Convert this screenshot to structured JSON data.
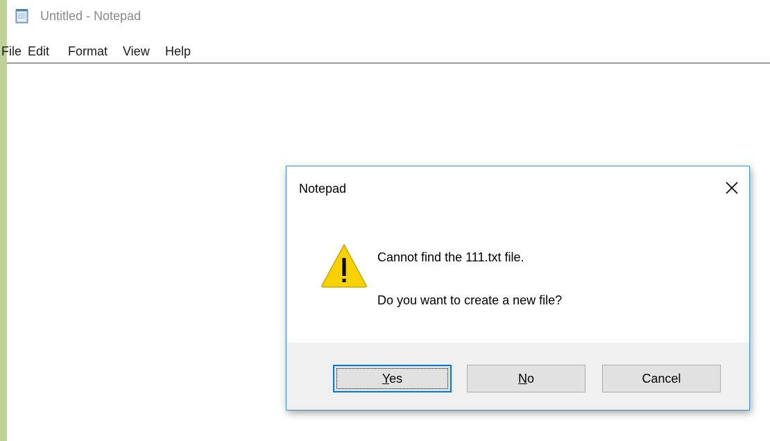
{
  "window": {
    "title": "Untitled - Notepad",
    "icon": "notepad-icon"
  },
  "menu": {
    "items": [
      "File",
      "Edit",
      "Format",
      "View",
      "Help"
    ]
  },
  "editor": {
    "content": ""
  },
  "dialog": {
    "title": "Notepad",
    "icon": "warning-icon",
    "message_line1": "Cannot find the 111.txt file.",
    "message_line2": "Do you want to create a new file?",
    "buttons": {
      "yes": {
        "mnemonic": "Y",
        "rest": "es"
      },
      "no": {
        "mnemonic": "N",
        "rest": "o"
      },
      "cancel": "Cancel"
    },
    "default_button": "yes"
  },
  "colors": {
    "desktop": "#bfd29a",
    "dialog_border": "#3d8ee0",
    "button_area": "#f0f0f0",
    "warning_yellow": "#f7d100"
  }
}
